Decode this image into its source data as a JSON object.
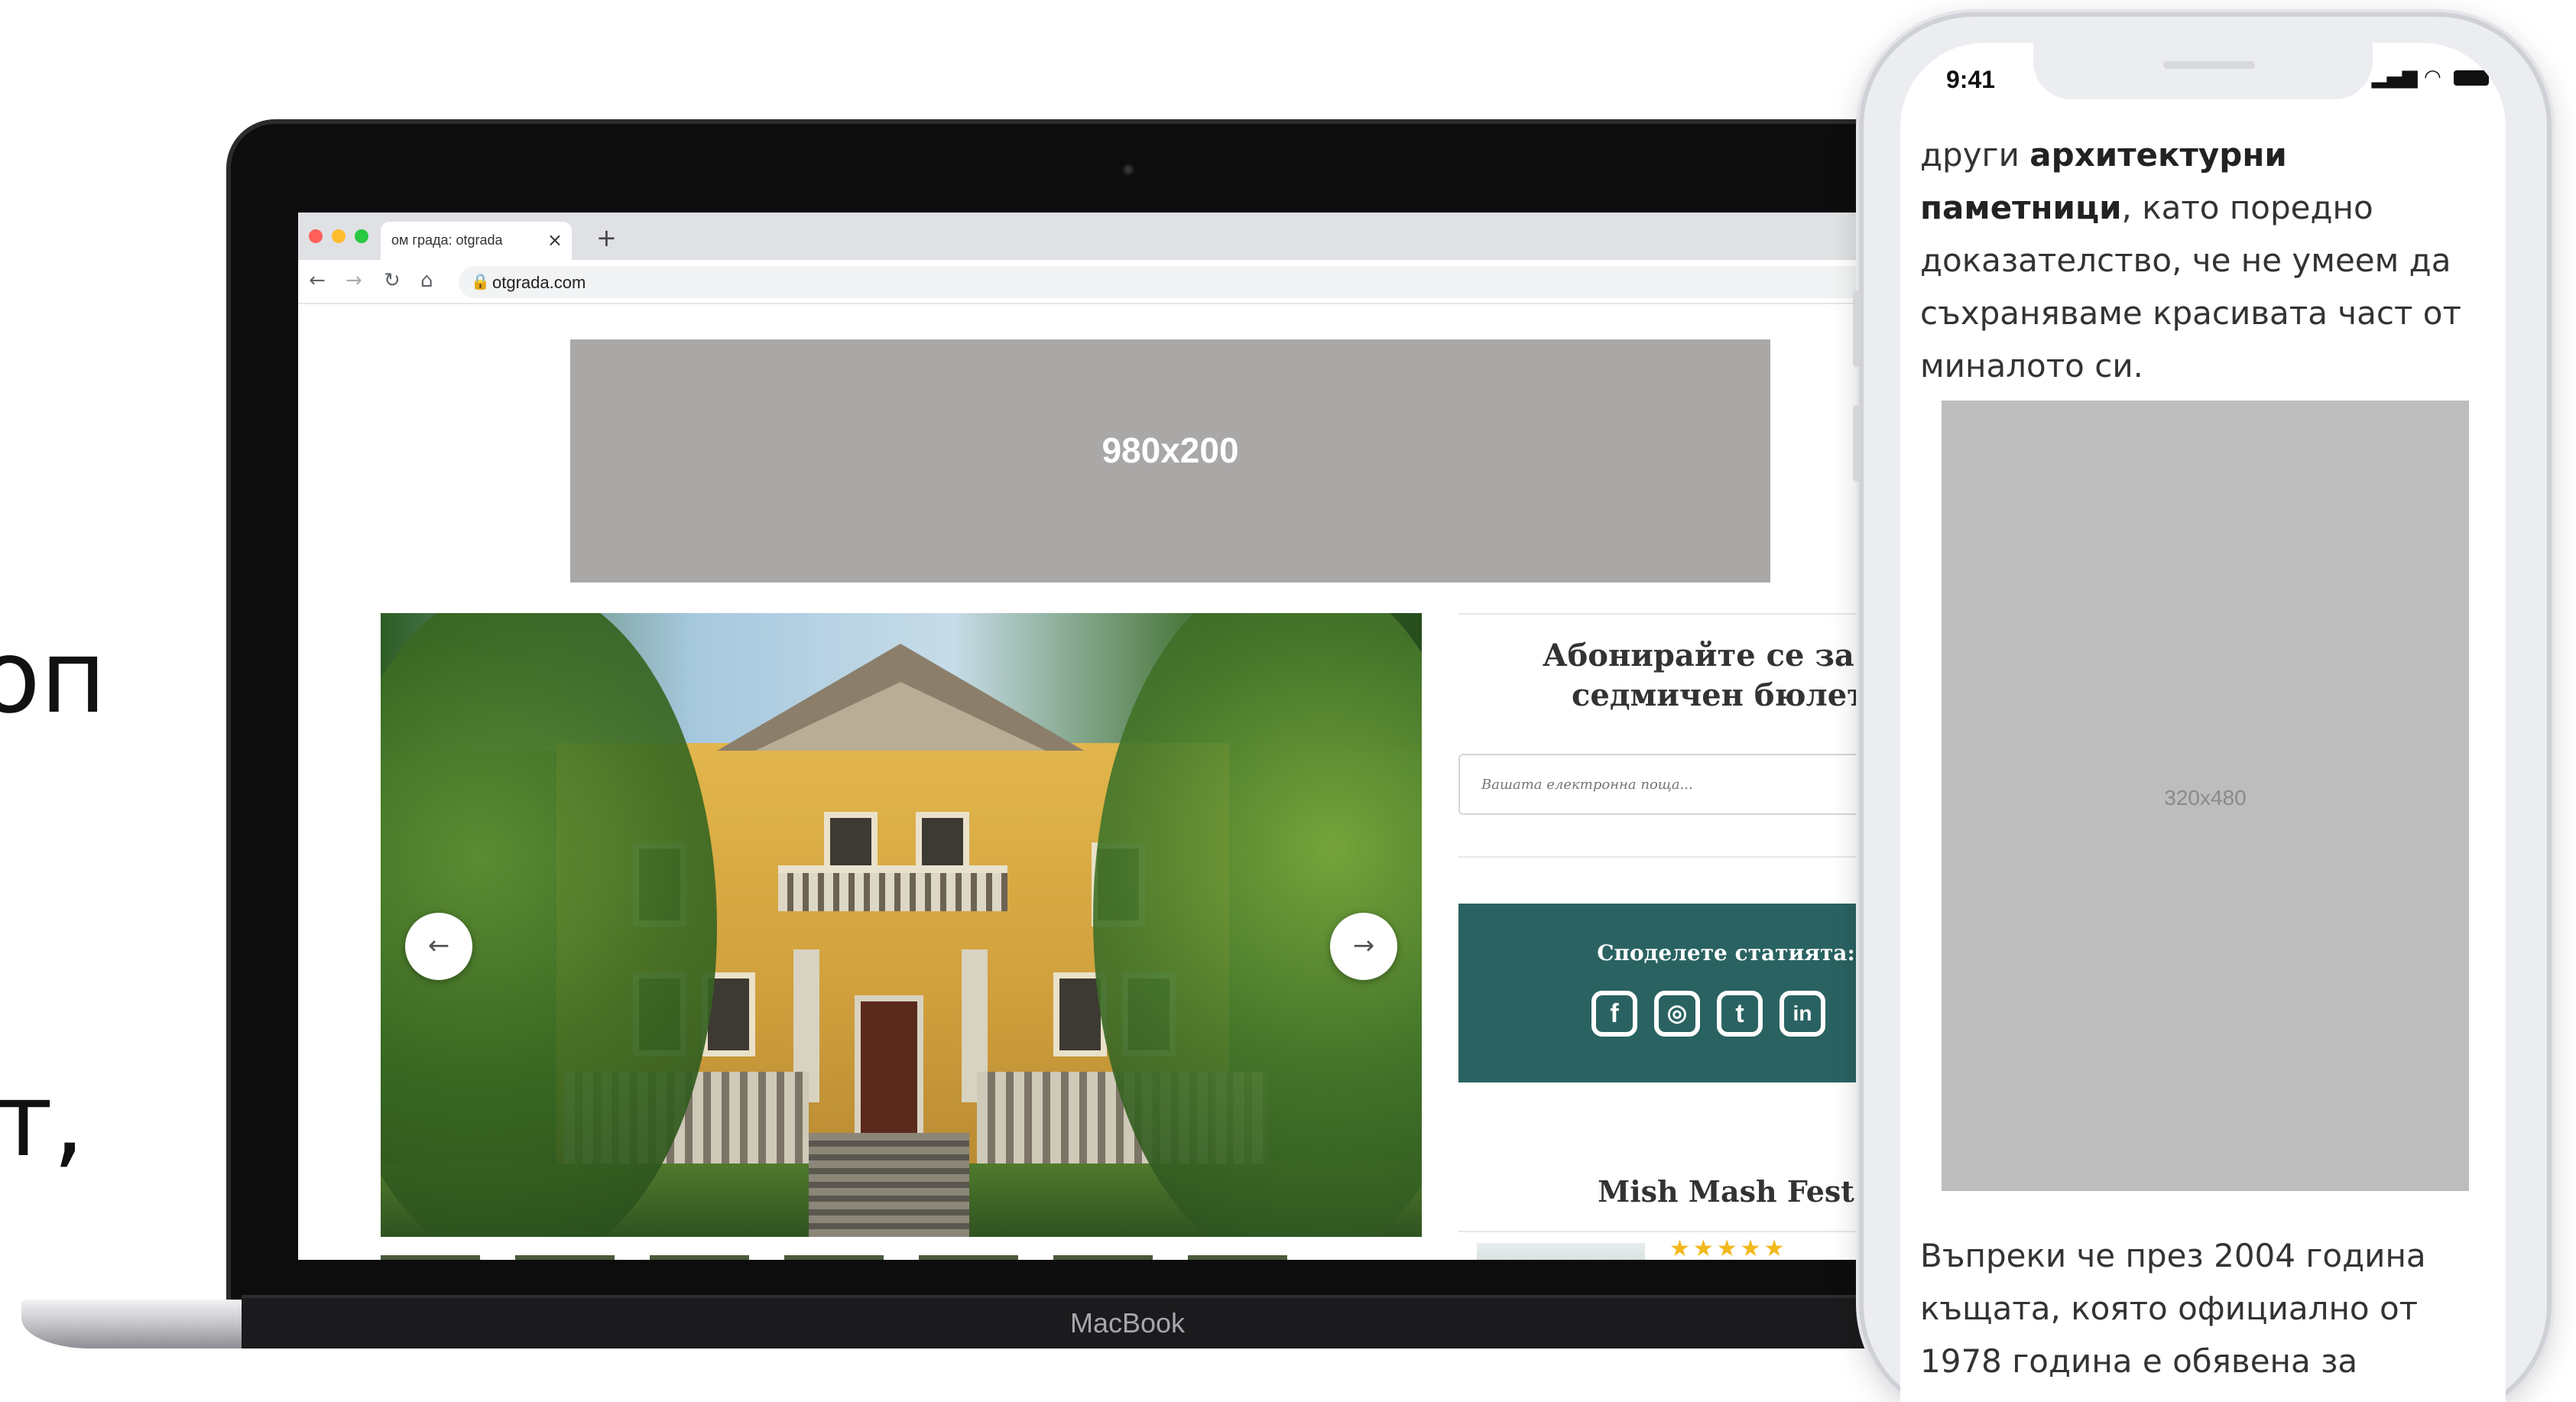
{
  "left_text": {
    "line1": "оп",
    "line2": "т,"
  },
  "macbook": {
    "brand": "MacBook"
  },
  "browser": {
    "tab_title": "ом града: otgrada",
    "tab_close": "×",
    "new_tab": "+",
    "url": "otgrada.com",
    "nav": {
      "back": "←",
      "forward": "→",
      "reload": "↻",
      "home": "⌂",
      "lock": "🔒"
    }
  },
  "page": {
    "banner_label": "980x200",
    "slider": {
      "prev": "←",
      "next": "→"
    },
    "newsletter": {
      "title_line1": "Абонирайте се за наш",
      "title_line2": "седмичен бюлетин",
      "email_placeholder": "Вашата електронна поща..."
    },
    "share": {
      "title": "Споделете статията:",
      "icons": [
        "facebook-icon",
        "instagram-icon",
        "twitter-icon",
        "linkedin-icon"
      ],
      "icon_glyphs": {
        "facebook": "f",
        "instagram": "◎",
        "twitter": "t",
        "linkedin": "in"
      }
    },
    "widget": {
      "title": "Mish Mash Fest",
      "rating_stars": "★★★★★",
      "rating": 5
    }
  },
  "phone": {
    "time": "9:41",
    "article_top": {
      "prefix": "други ",
      "bold": "архитектурни паметници",
      "rest": ", като поредно доказателство, че не умеем да съхраняваме красивата част от миналото си."
    },
    "ad_label": "320x480",
    "article_bottom": "Въпреки че през 2004 година къщата, която официално от 1978 година е обявена за паметник на"
  },
  "colors": {
    "banner": "#aaa7a7",
    "share_box": "#2a6262",
    "ad_box": "#bdbdbd",
    "stars": "#f2b81c"
  }
}
